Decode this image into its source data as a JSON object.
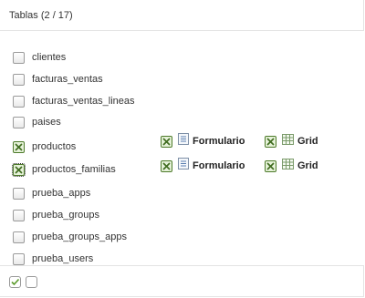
{
  "header": {
    "title": "Tablas (2 / 17)"
  },
  "tables": [
    {
      "label": "clientes",
      "checked": false
    },
    {
      "label": "facturas_ventas",
      "checked": false
    },
    {
      "label": "facturas_ventas_lineas",
      "checked": false
    },
    {
      "label": "paises",
      "checked": false
    },
    {
      "label": "productos",
      "checked": true
    },
    {
      "label": "productos_familias",
      "checked": true
    },
    {
      "label": "prueba_apps",
      "checked": false
    },
    {
      "label": "prueba_groups",
      "checked": false
    },
    {
      "label": "prueba_groups_apps",
      "checked": false
    },
    {
      "label": "prueba_users",
      "checked": false
    }
  ],
  "options": {
    "productos": {
      "form_label": "Formulario",
      "grid_label": "Grid"
    },
    "productos_familias": {
      "form_label": "Formulario",
      "grid_label": "Grid"
    }
  },
  "colors": {
    "check_green": "#4d7a2a",
    "border": "#e4e4e4"
  },
  "icons": {
    "select_all": "check-all-icon",
    "select_none": "uncheck-all-icon"
  }
}
